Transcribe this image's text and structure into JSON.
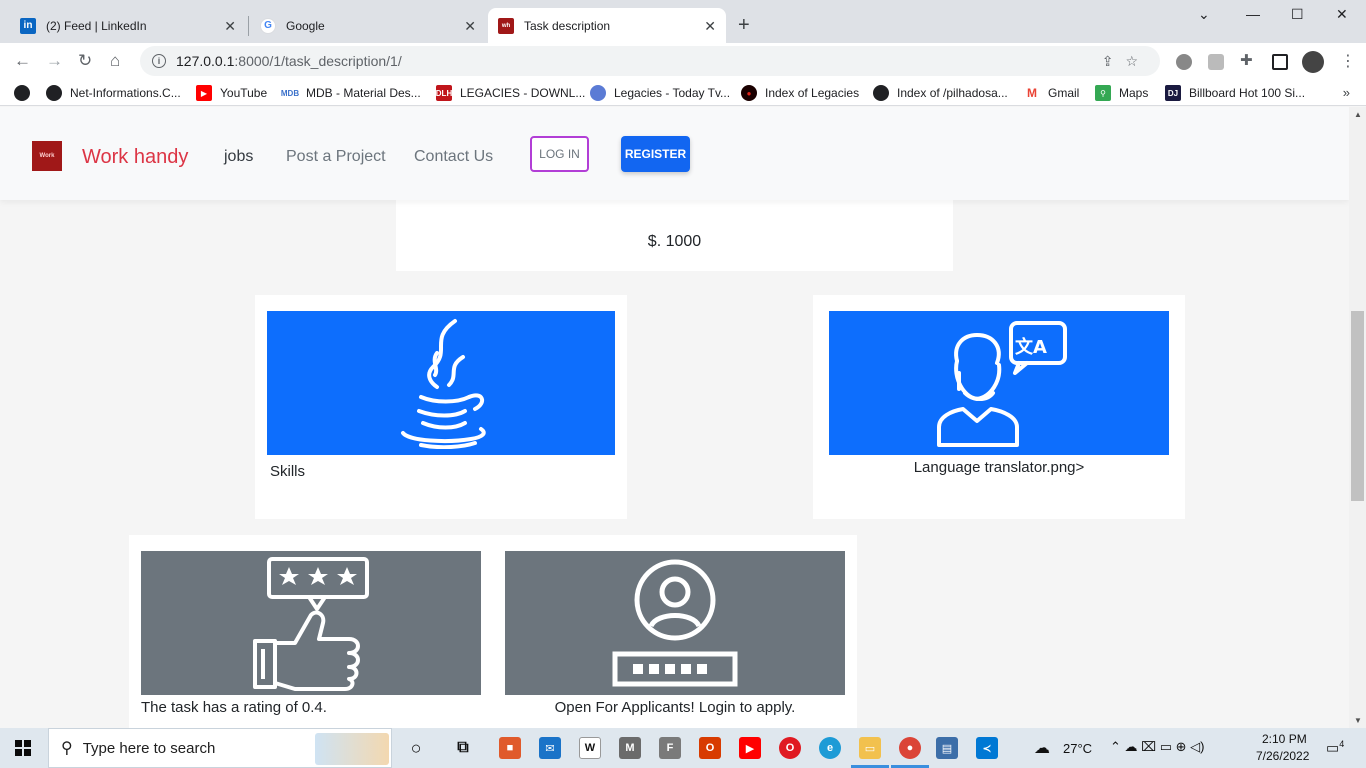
{
  "browser": {
    "tabs": [
      {
        "title": "(2) Feed | LinkedIn",
        "icon": "linkedin-icon"
      },
      {
        "title": "Google",
        "icon": "google-icon"
      },
      {
        "title": "Task description",
        "icon": "workhandy-icon"
      }
    ],
    "url_host": "127.0.0.1",
    "url_path": ":8000/1/task_description/1/",
    "bookmarks": [
      "Net-Informations.C...",
      "YouTube",
      "MDB - Material Des...",
      "LEGACIES - DOWNL...",
      "Legacies - Today Tv...",
      "Index of Legacies",
      "Index of /pilhadosa...",
      "Gmail",
      "Maps",
      "Billboard Hot 100 Si..."
    ]
  },
  "site": {
    "brand": "Work handy",
    "nav": {
      "jobs": "jobs",
      "post": "Post a Project",
      "contact": "Contact Us"
    },
    "login": "LOG IN",
    "register": "REGISTER",
    "brand_color": "#dc3545",
    "primary_color": "#1266f1"
  },
  "task": {
    "price": "$. 1000",
    "skills_caption": "Skills",
    "language_caption": "Language translator.png>",
    "rating_caption": "The task has a rating of 0.4.",
    "status_caption": "Open For Applicants! Login to apply."
  },
  "taskbar": {
    "search_placeholder": "Type here to search",
    "temperature": "27°C",
    "time": "2:10 PM",
    "date": "7/26/2022",
    "notifications": "4"
  }
}
